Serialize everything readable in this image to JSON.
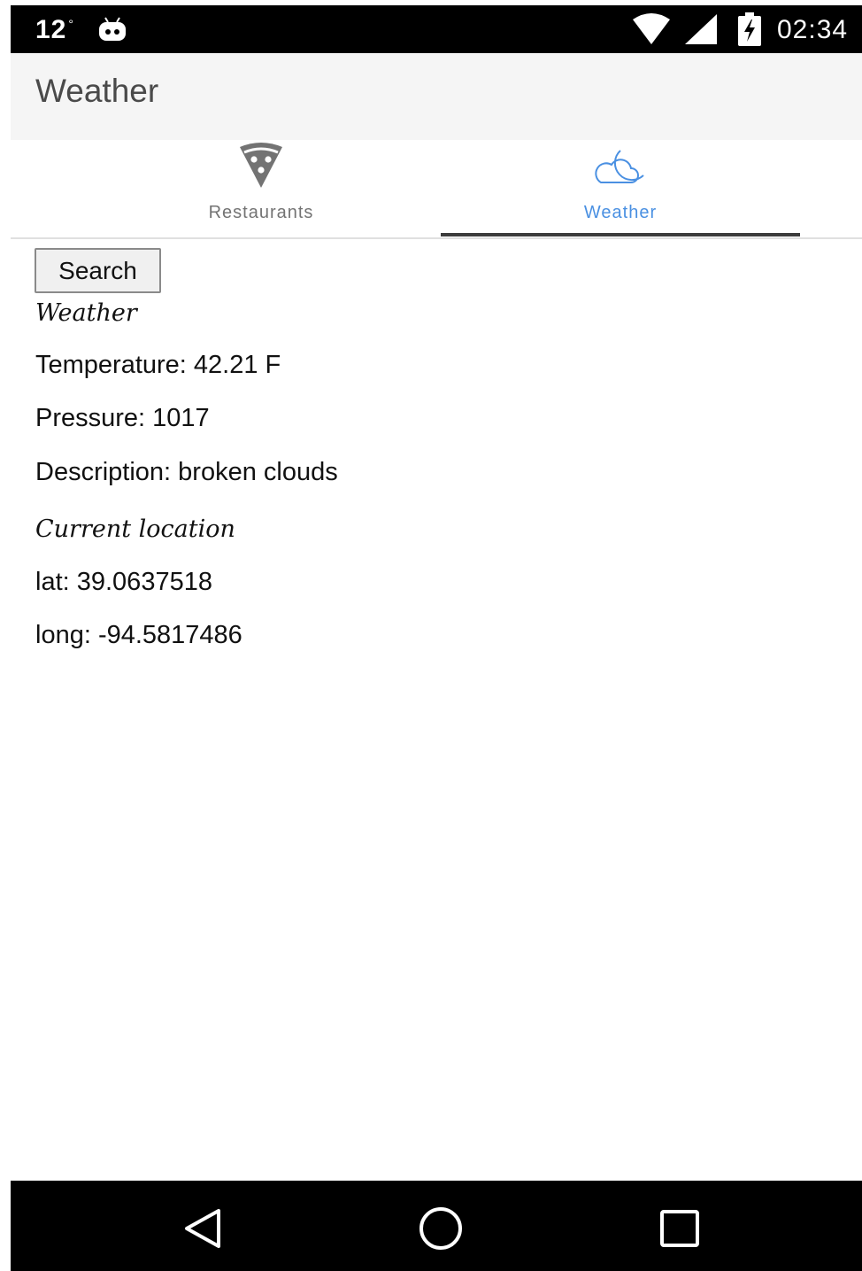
{
  "status_bar": {
    "temperature": "12",
    "degree_symbol": "°",
    "clock": "02:34",
    "icons": [
      "android-icon",
      "wifi-icon",
      "cell-signal-icon",
      "battery-charging-icon"
    ]
  },
  "app_bar": {
    "title": "Weather"
  },
  "tabs": [
    {
      "label": "Restaurants",
      "icon": "pizza-icon",
      "active": false
    },
    {
      "label": "Weather",
      "icon": "cloud-moon-icon",
      "active": true
    }
  ],
  "colors": {
    "active_tab": "#4a90e2",
    "inactive_tab": "#737373",
    "indicator": "#3c3c3c",
    "app_bar_bg": "#f5f5f5"
  },
  "content": {
    "search_label": "Search",
    "weather_heading": "Weather",
    "temperature": "Temperature: 42.21 F",
    "pressure": "Pressure: 1017",
    "description": "Description: broken clouds",
    "location_heading": "Current location",
    "lat": "lat: 39.0637518",
    "long": "long: -94.5817486"
  },
  "nav_bar": {
    "icons": [
      "back-icon",
      "home-icon",
      "recents-icon"
    ]
  }
}
